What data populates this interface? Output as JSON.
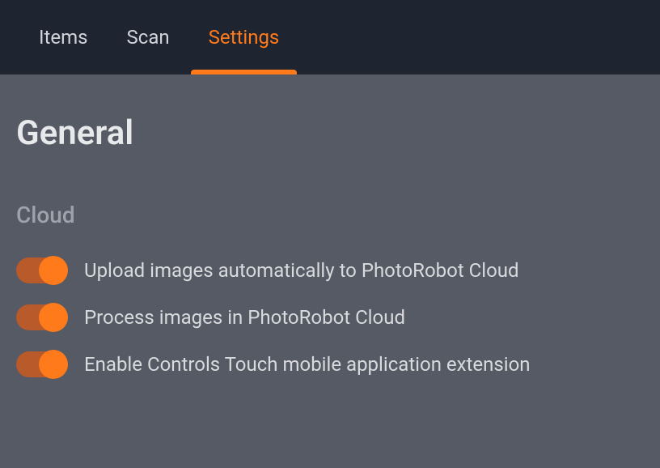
{
  "tabs": {
    "items": "Items",
    "scan": "Scan",
    "settings": "Settings"
  },
  "page": {
    "title": "General"
  },
  "sections": {
    "cloud": {
      "title": "Cloud",
      "settings": {
        "upload": {
          "label": "Upload images automatically to PhotoRobot Cloud",
          "enabled": true
        },
        "process": {
          "label": "Process images in PhotoRobot Cloud",
          "enabled": true
        },
        "controls_touch": {
          "label": "Enable Controls Touch mobile application extension",
          "enabled": true
        }
      }
    }
  }
}
